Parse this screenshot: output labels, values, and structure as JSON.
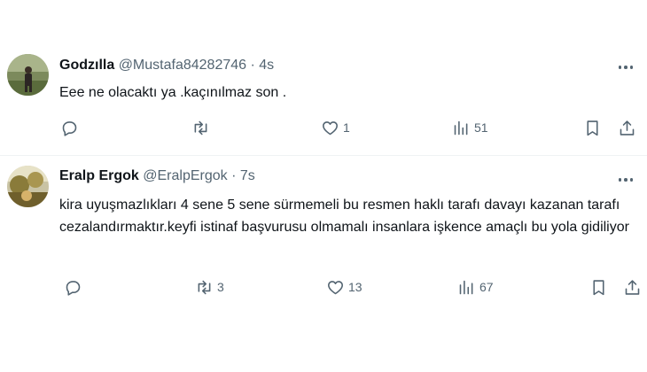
{
  "tweets": [
    {
      "name": "Godzılla",
      "handle": "@Mustafa84282746",
      "dot": "·",
      "time": "4s",
      "text": "Eee ne olacaktı ya .kaçınılmaz son .",
      "reply_count": "",
      "retweet_count": "",
      "like_count": "1",
      "view_count": "51",
      "avatar_icon": "avatar-photo"
    },
    {
      "name": "Eralp Ergok",
      "handle": "@EralpErgok",
      "dot": "·",
      "time": "7s",
      "text": "kira uyuşmazlıkları 4 sene 5 sene sürmemeli bu resmen haklı tarafı davayı kazanan tarafı cezalandırmaktır.keyfi istinaf başvurusu olmamalı insanlara işkence amaçlı bu yola gidiliyor",
      "reply_count": "",
      "retweet_count": "3",
      "like_count": "13",
      "view_count": "67",
      "avatar_icon": "avatar-photo"
    }
  ],
  "icons": [
    "reply-icon",
    "retweet-icon",
    "like-icon",
    "views-icon",
    "bookmark-icon",
    "share-icon",
    "more-icon"
  ],
  "colors": {
    "text": "#0f1419",
    "secondary": "#536471",
    "divider": "#eff3f4",
    "background": "#ffffff"
  }
}
